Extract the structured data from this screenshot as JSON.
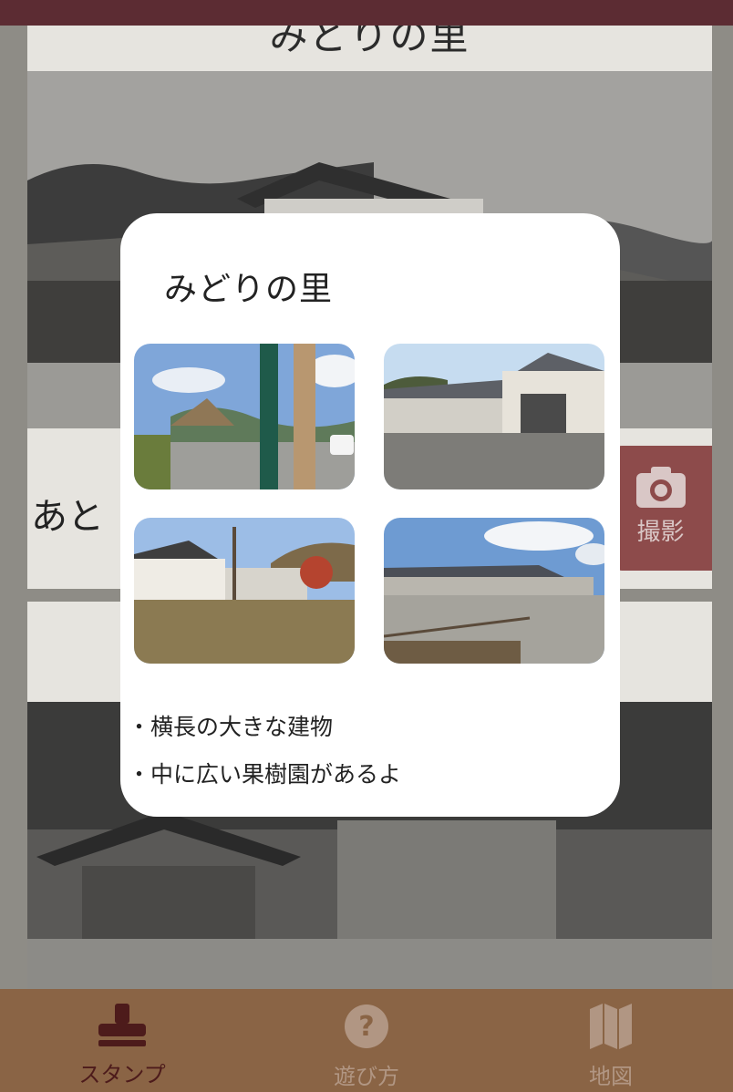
{
  "card": {
    "title": "みどりの里",
    "remaining_text": "あと"
  },
  "camera_button": {
    "label": "撮影",
    "icon": "camera-icon"
  },
  "modal": {
    "title": "みどりの里",
    "thumbnails": [
      {
        "icon": "photo-sign-post"
      },
      {
        "icon": "photo-building-front"
      },
      {
        "icon": "photo-building-tree"
      },
      {
        "icon": "photo-parking-lot"
      }
    ],
    "bullets": [
      "・横長の大きな建物",
      "・中に広い果樹園があるよ"
    ]
  },
  "nav": {
    "items": [
      {
        "label": "スタンプ",
        "icon": "stamp-icon",
        "active": true
      },
      {
        "label": "遊び方",
        "icon": "question-icon",
        "active": false
      },
      {
        "label": "地図",
        "icon": "map-icon",
        "active": false
      }
    ]
  },
  "colors": {
    "status_bar": "#5c2c33",
    "camera_button": "#8d4b4b",
    "nav_background": "#8a6445",
    "nav_active": "#4d1b1b",
    "nav_inactive": "#b19683",
    "modal_background": "#ffffff"
  }
}
